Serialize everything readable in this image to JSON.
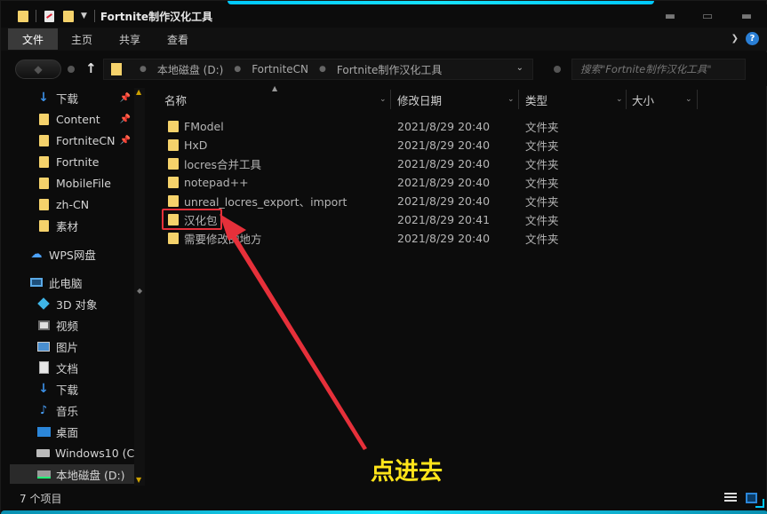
{
  "window": {
    "title": "Fortnite制作汉化工具"
  },
  "ribbon": {
    "tabs": [
      "文件",
      "主页",
      "共享",
      "查看"
    ]
  },
  "address": {
    "crumbs": [
      "本地磁盘 (D:)",
      "FortniteCN",
      "Fortnite制作汉化工具"
    ],
    "search_placeholder": "搜索\"Fortnite制作汉化工具\""
  },
  "nav": {
    "items": [
      {
        "label": "下载",
        "icon": "download-icon",
        "pinned": true
      },
      {
        "label": "Content",
        "icon": "folder-icon",
        "pinned": true
      },
      {
        "label": "FortniteCN",
        "icon": "folder-icon",
        "pinned": true
      },
      {
        "label": "Fortnite",
        "icon": "folder-icon",
        "pinned": false
      },
      {
        "label": "MobileFile",
        "icon": "folder-icon",
        "pinned": false
      },
      {
        "label": "zh-CN",
        "icon": "folder-icon",
        "pinned": false
      },
      {
        "label": "素材",
        "icon": "folder-icon",
        "pinned": false
      },
      {
        "label": "WPS网盘",
        "icon": "cloud-icon",
        "pinned": false
      },
      {
        "label": "此电脑",
        "icon": "computer-icon",
        "pinned": false
      },
      {
        "label": "3D 对象",
        "icon": "3d-objects-icon",
        "pinned": false
      },
      {
        "label": "视频",
        "icon": "video-icon",
        "pinned": false
      },
      {
        "label": "图片",
        "icon": "pictures-icon",
        "pinned": false
      },
      {
        "label": "文档",
        "icon": "documents-icon",
        "pinned": false
      },
      {
        "label": "下载",
        "icon": "download-icon",
        "pinned": false
      },
      {
        "label": "音乐",
        "icon": "music-icon",
        "pinned": false
      },
      {
        "label": "桌面",
        "icon": "desktop-icon",
        "pinned": false
      },
      {
        "label": "Windows10 (C:",
        "icon": "drive-icon",
        "pinned": false
      },
      {
        "label": "本地磁盘 (D:)",
        "icon": "drive-icon",
        "pinned": false
      }
    ]
  },
  "columns": {
    "name": "名称",
    "date": "修改日期",
    "type": "类型",
    "size": "大小"
  },
  "files": [
    {
      "name": "FModel",
      "date": "2021/8/29 20:40",
      "type": "文件夹"
    },
    {
      "name": "HxD",
      "date": "2021/8/29 20:40",
      "type": "文件夹"
    },
    {
      "name": "locres合并工具",
      "date": "2021/8/29 20:40",
      "type": "文件夹"
    },
    {
      "name": "notepad++",
      "date": "2021/8/29 20:40",
      "type": "文件夹"
    },
    {
      "name": "unreal_locres_export、import",
      "date": "2021/8/29 20:40",
      "type": "文件夹"
    },
    {
      "name": "汉化包",
      "date": "2021/8/29 20:41",
      "type": "文件夹"
    },
    {
      "name": "需要修改的地方",
      "date": "2021/8/29 20:40",
      "type": "文件夹"
    }
  ],
  "annotation": {
    "text": "点进去",
    "color": "#ffe41a",
    "highlight_color": "#e6303a"
  },
  "status": {
    "count": "7 个项目"
  },
  "theme": {
    "accent": "#17e2ff",
    "folder": "#f5d26b",
    "background": "#0c0c0c"
  }
}
